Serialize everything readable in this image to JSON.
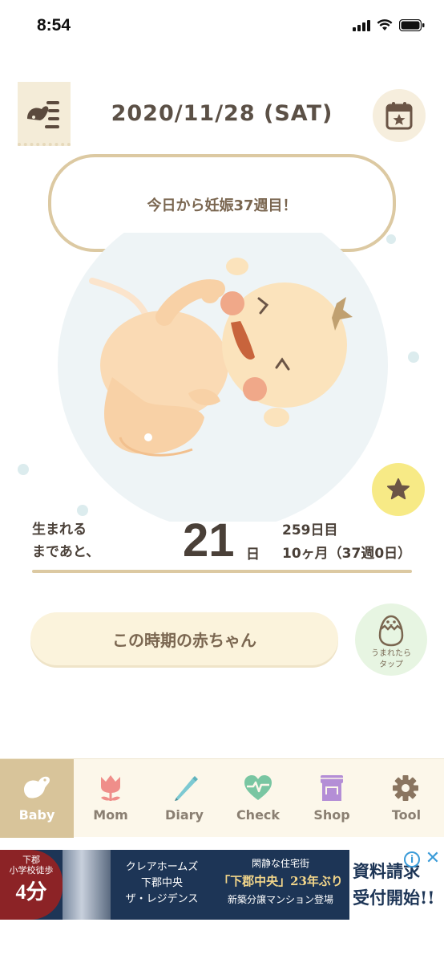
{
  "status_bar": {
    "time": "8:54"
  },
  "header": {
    "date": "2020/11/28 (SAT)"
  },
  "bubble": {
    "message": "今日から妊娠37週目！"
  },
  "countdown": {
    "label_line1": "生まれる",
    "label_line2": "まであと、",
    "days_left": "21",
    "days_unit": "日",
    "day_count": "259日目",
    "month_week": "10ヶ月（37週0日）"
  },
  "period_button": {
    "label": "この時期の赤ちゃん"
  },
  "egg_button": {
    "line1": "うまれたら",
    "line2": "タップ"
  },
  "tabs": [
    {
      "label": "Baby",
      "icon": "bird-icon",
      "active": true
    },
    {
      "label": "Mom",
      "icon": "tulip-icon",
      "active": false
    },
    {
      "label": "Diary",
      "icon": "pencil-icon",
      "active": false
    },
    {
      "label": "Check",
      "icon": "heart-pulse-icon",
      "active": false
    },
    {
      "label": "Shop",
      "icon": "shop-icon",
      "active": false
    },
    {
      "label": "Tool",
      "icon": "gear-icon",
      "active": false
    }
  ],
  "ad": {
    "badge_line1": "下郡",
    "badge_line2": "小学校徒歩",
    "badge_big": "4分",
    "col1_line1": "クレアホームズ",
    "col1_line2": "下郡中央",
    "col1_line3": "ザ・レジデンス",
    "col2_line1": "閑静な住宅街",
    "col2_line2": "「下郡中央」23年ぶり",
    "col2_line3": "新築分譲マンション登場",
    "cta_line1": "資料請求",
    "cta_line2": "受付開始!!"
  },
  "colors": {
    "accent": "#d8c49a",
    "bubble_border": "#dcc9a2",
    "star_button": "#f7ea86",
    "egg_button": "#e7f5e2",
    "tab_bar": "#fcf7ea"
  }
}
